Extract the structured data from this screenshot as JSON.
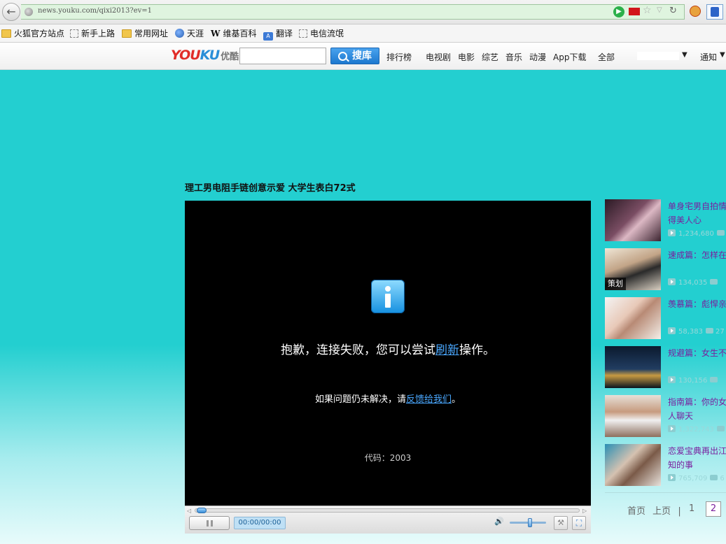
{
  "browser": {
    "url": "news.youku.com/qixi2013?ev=1"
  },
  "bookmarks": [
    {
      "label": "火狐官方站点",
      "icon": "folder-icon"
    },
    {
      "label": "新手上路",
      "icon": "blank-page-icon"
    },
    {
      "label": "常用网址",
      "icon": "folder-icon"
    },
    {
      "label": "天涯",
      "icon": "tianya-icon"
    },
    {
      "label": "维基百科",
      "icon": "wikipedia-icon"
    },
    {
      "label": "翻译",
      "icon": "translate-icon"
    },
    {
      "label": "电信流氓",
      "icon": "blank-page-icon"
    }
  ],
  "header": {
    "logo_you": "YOU",
    "logo_ku": "KU",
    "logo_cn": "优酷",
    "search_button": "搜库",
    "nav": [
      "排行榜",
      "电视剧",
      "电影",
      "综艺",
      "音乐",
      "动漫",
      "App下载",
      "全部"
    ],
    "notice": "通知"
  },
  "video": {
    "title": "理工男电阻手链创意示爱 大学生表白72式",
    "error_main_prefix": "抱歉，连接失败，您可以尝试",
    "error_main_link": "刷新",
    "error_main_suffix": "操作。",
    "error_sub_prefix": "如果问题仍未解决，请",
    "error_sub_link": "反馈给我们",
    "error_sub_suffix": "。",
    "error_code": "代码：2003",
    "time": "00:00/00:00"
  },
  "related": [
    {
      "title": "单身宅男自拍情得美人心",
      "views": "1,234,680",
      "comments": "",
      "badge": ""
    },
    {
      "title": "速成篇：怎样在",
      "views": "134,035",
      "comments": "",
      "badge": "策划"
    },
    {
      "title": "羡慕篇：彪悍亲",
      "views": "58,383",
      "comments": "27",
      "badge": ""
    },
    {
      "title": "规避篇：女生不",
      "views": "130,156",
      "comments": "",
      "badge": ""
    },
    {
      "title": "指南篇：你的女人聊天",
      "views": "1,322,743",
      "comments": "",
      "badge": ""
    },
    {
      "title": "恋爱宝典再出江知的事",
      "views": "765,709",
      "comments": "6",
      "badge": ""
    }
  ],
  "pager": {
    "first": "首页",
    "prev": "上页",
    "sep": "|",
    "page1": "1",
    "page2": "2"
  },
  "colors": {
    "page_bg": "#23cfd0",
    "related_title": "#7a1f9e",
    "link": "#4aa8ff",
    "search_btn": "#1c78cf"
  }
}
